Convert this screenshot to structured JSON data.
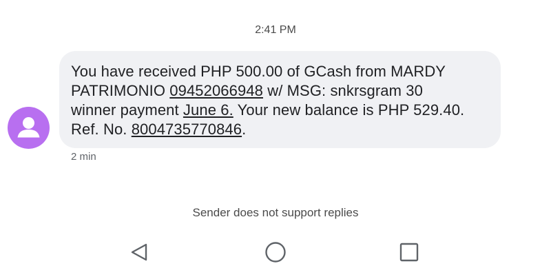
{
  "header": {
    "time": "2:41 PM"
  },
  "message": {
    "lines": [
      [
        {
          "text": "You have received PHP 500.00 of GCash from MARDY"
        }
      ],
      [
        {
          "text": "PATRIMONIO "
        },
        {
          "text": "09452066948",
          "link": true
        },
        {
          "text": " w/ MSG: snkrsgram 30"
        }
      ],
      [
        {
          "text": "winner payment "
        },
        {
          "text": "June 6.",
          "link": true
        },
        {
          "text": " Your new balance is PHP 529.40."
        }
      ],
      [
        {
          "text": "Ref. No. "
        },
        {
          "text": "8004735770846",
          "link": true
        },
        {
          "text": "."
        }
      ]
    ],
    "elapsed": "2 min"
  },
  "footer": {
    "notice": "Sender does not support replies"
  },
  "colors": {
    "avatar": "#b86ff0",
    "bubble": "#f0f1f4",
    "text": "#202124"
  },
  "icons": {
    "avatar": "person-icon",
    "back": "back-triangle-icon",
    "home": "home-circle-icon",
    "recents": "recents-square-icon"
  }
}
